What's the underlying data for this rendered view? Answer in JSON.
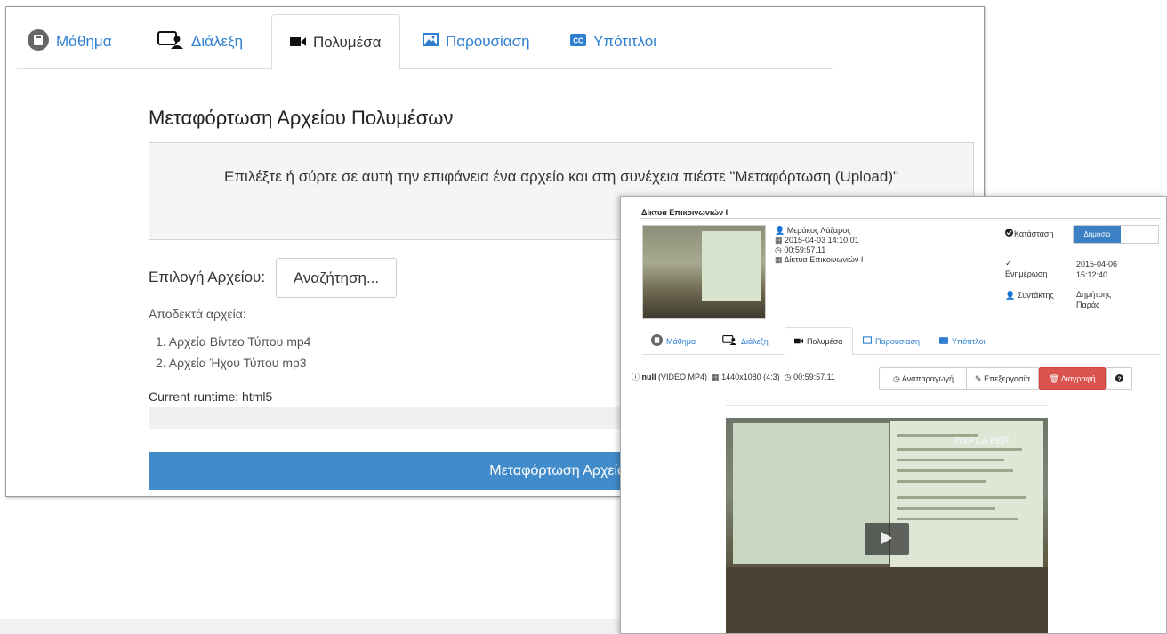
{
  "upload_window": {
    "tabs": [
      {
        "label": "Μάθημα"
      },
      {
        "label": "Διάλεξη"
      },
      {
        "label": "Πολυμέσα"
      },
      {
        "label": "Παρουσίαση"
      },
      {
        "label": "Υπότιτλοι"
      }
    ],
    "active_tab": "Πολυμέσα",
    "title": "Μεταφόρτωση Αρχείου Πολυμέσων",
    "dropzone_text": "Επιλέξτε ή σύρτε σε αυτή την επιφάνεια ένα αρχείο και στη συνέχεια πιέστε \"Μεταφόρτωση (Upload)\"",
    "choose_label": "Επιλογή Αρχείου:",
    "browse_label": "Αναζήτηση...",
    "accepted_label": "Αποδεκτά αρχεία:",
    "accepted_files": [
      "1. Αρχεία Βίντεο Τύπου mp4",
      "2. Αρχεία Ήχου Τύπου mp3"
    ],
    "runtime": "Current runtime: html5",
    "upload_button": "Μεταφόρτωση Αρχείου"
  },
  "detail_window": {
    "course_title": "Δίκτυα Επικοινωνιών Ι",
    "author": "Μεράκος Λάζαρος",
    "date": "2015-04-03  14:10:01",
    "duration": "00:59:57.11",
    "course": "Δίκτυα Επικοινωνιών Ι",
    "state_label": "Κατάσταση",
    "state_value": "Δημόσιο",
    "updated_label": "Ενημέρωση",
    "updated_value": "2015-04-06 15:12:40",
    "editor_label": "Συντάκτης",
    "editor_value": "Δημήτρης Παράς",
    "tabs": [
      {
        "label": "Μάθημα"
      },
      {
        "label": "Διάλεξη"
      },
      {
        "label": "Πολυμέσα"
      },
      {
        "label": "Παρουσίαση"
      },
      {
        "label": "Υπότιτλοι"
      }
    ],
    "file_name": "null",
    "file_type": "(VIDEO MP4)",
    "resolution": "1440x1080 (4:3)",
    "file_duration": "00:59:57.11",
    "play_button": "Αναπαραγωγή",
    "edit_button": "Επεξεργασία",
    "delete_button": "Διαγραφή",
    "player_brand": "JWPLAYER"
  },
  "colors": {
    "link": "#2f7fd1",
    "primary": "#428bca",
    "danger": "#d9534f"
  }
}
